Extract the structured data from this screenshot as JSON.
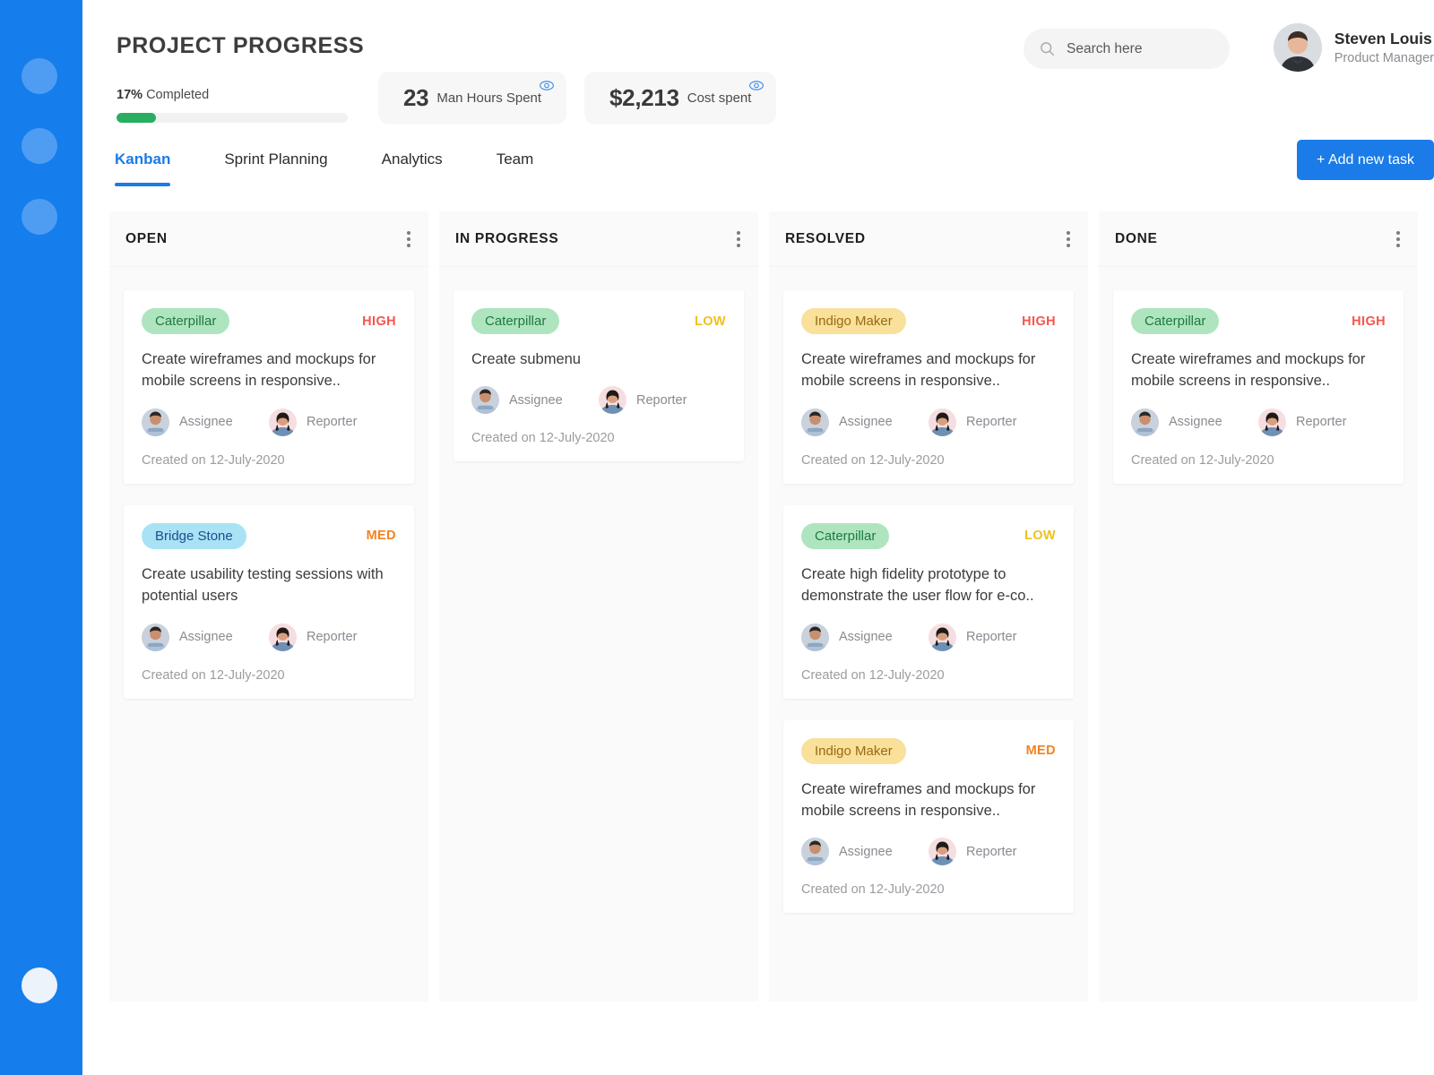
{
  "sidebar": {
    "items": [
      {
        "name": "nav-dot-1"
      },
      {
        "name": "nav-dot-2"
      },
      {
        "name": "nav-dot-3"
      }
    ],
    "active_item": {
      "name": "nav-dot-active"
    },
    "background_color": "#157EEC",
    "dot_color": "#4E9DF2"
  },
  "header": {
    "title": "PROJECT PROGRESS",
    "progress": {
      "percent_label": "17%",
      "completed_label": "Completed",
      "percent_value": 17,
      "fill_color": "#27AE60",
      "track_color": "#F1F1F1"
    },
    "stats": [
      {
        "value": "23",
        "label": "Man Hours Spent",
        "icon": "eye-icon"
      },
      {
        "value": "$2,213",
        "label": "Cost spent",
        "icon": "eye-icon"
      }
    ],
    "search": {
      "placeholder": "Search here",
      "value": "",
      "icon": "search-icon"
    },
    "user": {
      "name": "Steven Louis",
      "role": "Product Manager"
    }
  },
  "tabs": {
    "items": [
      {
        "label": "Kanban",
        "active": true
      },
      {
        "label": "Sprint Planning",
        "active": false
      },
      {
        "label": "Analytics",
        "active": false
      },
      {
        "label": "Team",
        "active": false
      }
    ],
    "accent_color": "#1B7BE8"
  },
  "actions": {
    "add_task_label": "+ Add new task"
  },
  "board": {
    "columns": [
      {
        "title": "OPEN",
        "menu_icon": "kebab-menu-icon",
        "cards": [
          {
            "tag": "Caterpillar",
            "tag_style": "green",
            "priority": "HIGH",
            "priority_style": "high",
            "text": "Create wireframes and mockups for mobile screens in responsive..",
            "assignee_label": "Assignee",
            "reporter_label": "Reporter",
            "created": "Created on 12-July-2020"
          },
          {
            "tag": "Bridge Stone",
            "tag_style": "blue",
            "priority": "MED",
            "priority_style": "med",
            "text": "Create usability testing sessions with potential users",
            "assignee_label": "Assignee",
            "reporter_label": "Reporter",
            "created": "Created on 12-July-2020"
          }
        ]
      },
      {
        "title": "IN PROGRESS",
        "menu_icon": "kebab-menu-icon",
        "cards": [
          {
            "tag": "Caterpillar",
            "tag_style": "green",
            "priority": "LOW",
            "priority_style": "low",
            "text": "Create submenu",
            "assignee_label": "Assignee",
            "reporter_label": "Reporter",
            "created": "Created on 12-July-2020"
          }
        ]
      },
      {
        "title": "RESOLVED",
        "menu_icon": "kebab-menu-icon",
        "cards": [
          {
            "tag": "Indigo Maker",
            "tag_style": "yellow",
            "priority": "HIGH",
            "priority_style": "high",
            "text": "Create wireframes and mockups for mobile screens in responsive..",
            "assignee_label": "Assignee",
            "reporter_label": "Reporter",
            "created": "Created on 12-July-2020"
          },
          {
            "tag": "Caterpillar",
            "tag_style": "green",
            "priority": "LOW",
            "priority_style": "low",
            "text": "Create high fidelity prototype to demonstrate the user flow for e-co..",
            "assignee_label": "Assignee",
            "reporter_label": "Reporter",
            "created": "Created on 12-July-2020"
          },
          {
            "tag": "Indigo Maker",
            "tag_style": "yellow",
            "priority": "MED",
            "priority_style": "med",
            "text": "Create wireframes and mockups for mobile screens in responsive..",
            "assignee_label": "Assignee",
            "reporter_label": "Reporter",
            "created": "Created on 12-July-2020"
          }
        ]
      },
      {
        "title": "DONE",
        "menu_icon": "kebab-menu-icon",
        "cards": [
          {
            "tag": "Caterpillar",
            "tag_style": "green",
            "priority": "HIGH",
            "priority_style": "high",
            "text": "Create wireframes and mockups for mobile screens in responsive..",
            "assignee_label": "Assignee",
            "reporter_label": "Reporter",
            "created": "Created on 12-July-2020"
          }
        ]
      }
    ]
  }
}
